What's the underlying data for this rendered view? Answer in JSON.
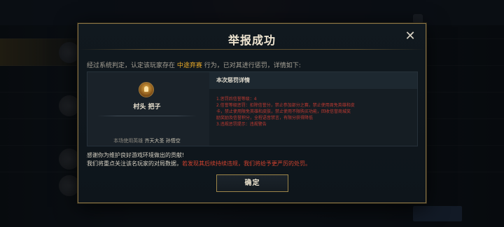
{
  "dialog": {
    "title": "举报成功",
    "close_icon": "close-icon",
    "intro_prefix": "经过系统判定，认定该玩家存在",
    "intro_highlight": "中途弃赛",
    "intro_suffix": "行为，已对其进行惩罚，详情如下:",
    "player": {
      "avatar_icon": "player-avatar-icon",
      "name": "村头 把子",
      "hero_prefix": "本场使用英雄",
      "hero_name": "齐天大圣 孙悟空"
    },
    "penalty": {
      "header": "本次惩罚详情",
      "items": [
        "1.惩罚后信誉等级：4",
        "2.信誉等级惩罚：扣除信誉分，禁止参加部分之赛，禁止使用周免英雄和皮",
        "卡，禁止使用限免英雄和皮肤，禁止使用不限购买功能，回收信誉商城奖",
        "励奖励及信誉积分，全程语音禁言，有限分获得降低",
        "3.违规惩罚提示：违规警告"
      ]
    },
    "thanks_line1": "感谢你为维护良好游戏环境做出的贡献!",
    "thanks_line2_prefix": "我们将重点关注该名玩家的对局数据，",
    "thanks_line2_warning": "若发现其后续持续违规，我们将给予更严厉的处罚。",
    "confirm_label": "确定"
  },
  "colors": {
    "accent_gold": "#e6a828",
    "warning_red": "#d0432f",
    "border_gold": "#8a7445"
  }
}
